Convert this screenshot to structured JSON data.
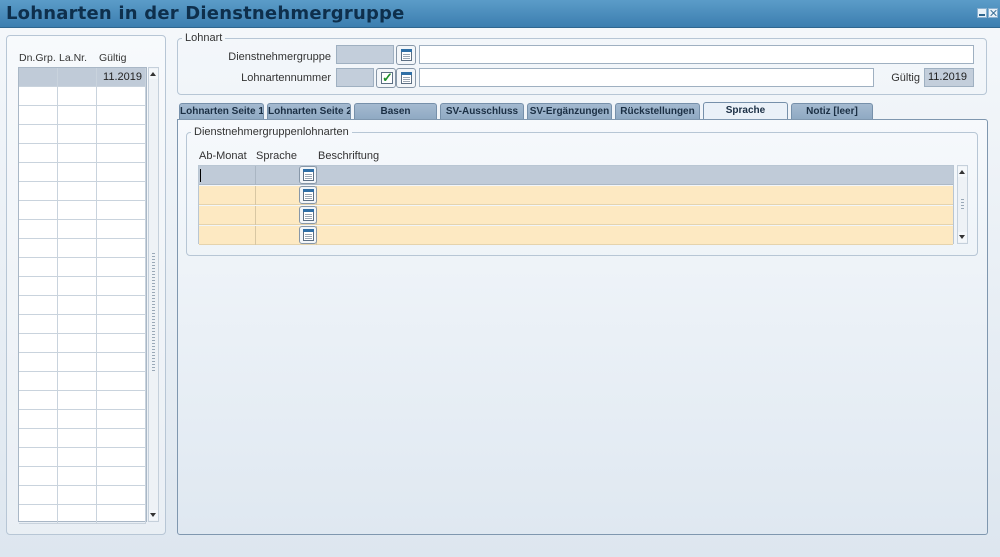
{
  "window": {
    "title": "Lohnarten in der Dienstnehmergruppe"
  },
  "left_panel": {
    "columns": [
      "Dn.Grp.",
      "La.Nr.",
      "Gültig"
    ],
    "rows": [
      {
        "dngrp": "",
        "lanr": "",
        "gueltig": "11.2019"
      }
    ]
  },
  "lohnart": {
    "legend": "Lohnart",
    "dienstnehmergruppe_label": "Dienstnehmergruppe",
    "dienstnehmergruppe_value": "",
    "dienstnehmergruppe_text": "",
    "lohnartennummer_label": "Lohnartennummer",
    "lohnartennummer_value": "",
    "lohnartennummer_text": "",
    "gueltig_label": "Gültig",
    "gueltig_value": "11.2019"
  },
  "tabs": [
    {
      "label": "Lohnarten Seite 1",
      "active": false
    },
    {
      "label": "Lohnarten Seite 2",
      "active": false
    },
    {
      "label": "Basen",
      "active": false
    },
    {
      "label": "SV-Ausschluss",
      "active": false
    },
    {
      "label": "SV-Ergänzungen",
      "active": false
    },
    {
      "label": "Rückstellungen",
      "active": false
    },
    {
      "label": "Sprache",
      "active": true
    },
    {
      "label": "Notiz [leer]",
      "active": false
    }
  ],
  "sprache": {
    "group_legend": "Dienstnehmergruppenlohnarten",
    "columns": [
      "Ab-Monat",
      "Sprache",
      "Beschriftung"
    ]
  },
  "colors": {
    "titlebar": "#4b8dbe",
    "selected_row": "#c0cbd8",
    "empty_row": "#fde9c2",
    "tab": "#9bb3cb"
  },
  "icons": [
    "calendar-icon",
    "check-icon",
    "minimize-icon",
    "close-icon",
    "scroll-up-icon",
    "scroll-down-icon"
  ]
}
